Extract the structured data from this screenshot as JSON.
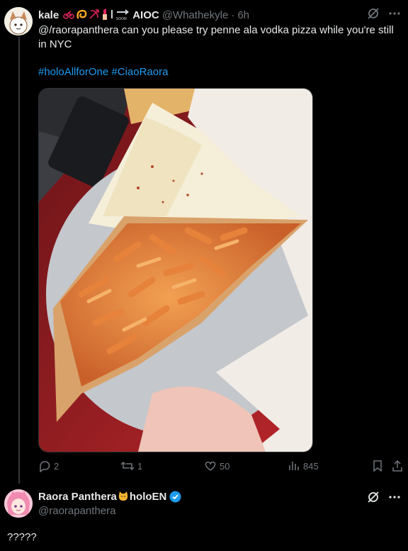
{
  "tweet": {
    "name": "kale",
    "emojis": [
      "motorcycle",
      "orange-swirl",
      "bow-arrow",
      "lipstick",
      "bar",
      "soon-arrow"
    ],
    "org": "AIOC",
    "handle": "@Whathekyle",
    "separator": "·",
    "time": "6h",
    "text": "@/raorapanthera can you please try penne ala vodka pizza while you're still in NYC",
    "hashtags": [
      "#holoAllforOne",
      "#CiaoRaora"
    ],
    "stats": {
      "replies": "2",
      "retweets": "1",
      "likes": "50",
      "views": "845"
    }
  },
  "reply": {
    "name": "Raora Panthera",
    "emoji": "cat-icon",
    "suffix": "holoEN",
    "handle": "@raorapanthera",
    "text": "?????"
  },
  "colors": {
    "background": "#000000",
    "text": "#e7e9ea",
    "muted": "#71767b",
    "link": "#1d9bf0",
    "verified": "#1d9bf0"
  }
}
